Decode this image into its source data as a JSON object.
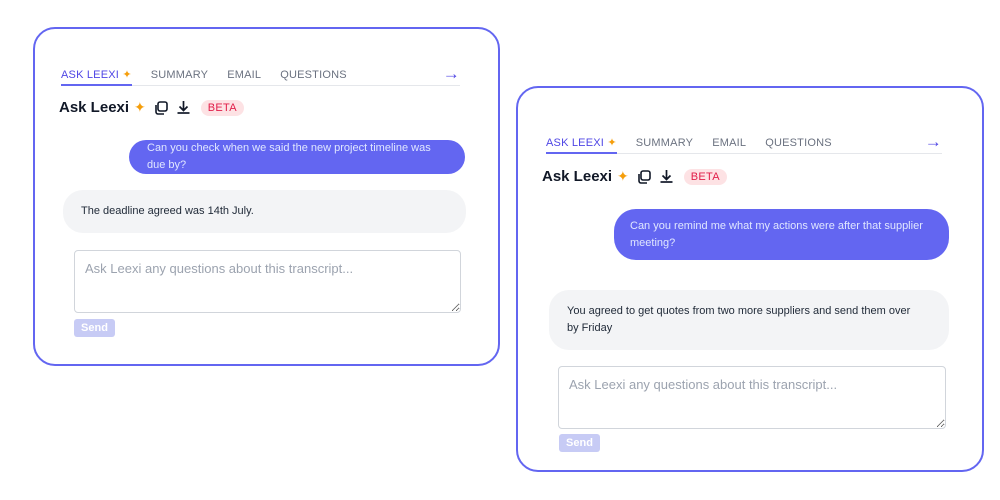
{
  "tabs": [
    "ASK LEEXI",
    "SUMMARY",
    "EMAIL",
    "QUESTIONS"
  ],
  "title": "Ask Leexi",
  "beta": "BETA",
  "input_placeholder": "Ask Leexi any questions about this transcript...",
  "send_label": "Send",
  "icons": {
    "sparkle": "sparkle-icon",
    "copy": "copy-icon",
    "download": "download-icon",
    "next": "arrow-right-icon"
  },
  "colors": {
    "accent": "#6366f1",
    "beta_bg": "#fde2e4",
    "beta_text": "#e11d48",
    "bot_bubble": "#f3f4f6"
  },
  "chat1": {
    "user": "Can you check when we said the new project timeline was due by?",
    "bot": "The deadline agreed was 14th July."
  },
  "chat2": {
    "user": "Can you remind me what my actions were after that supplier meeting?",
    "bot": "You agreed to get quotes from two more suppliers and send them over by Friday"
  }
}
